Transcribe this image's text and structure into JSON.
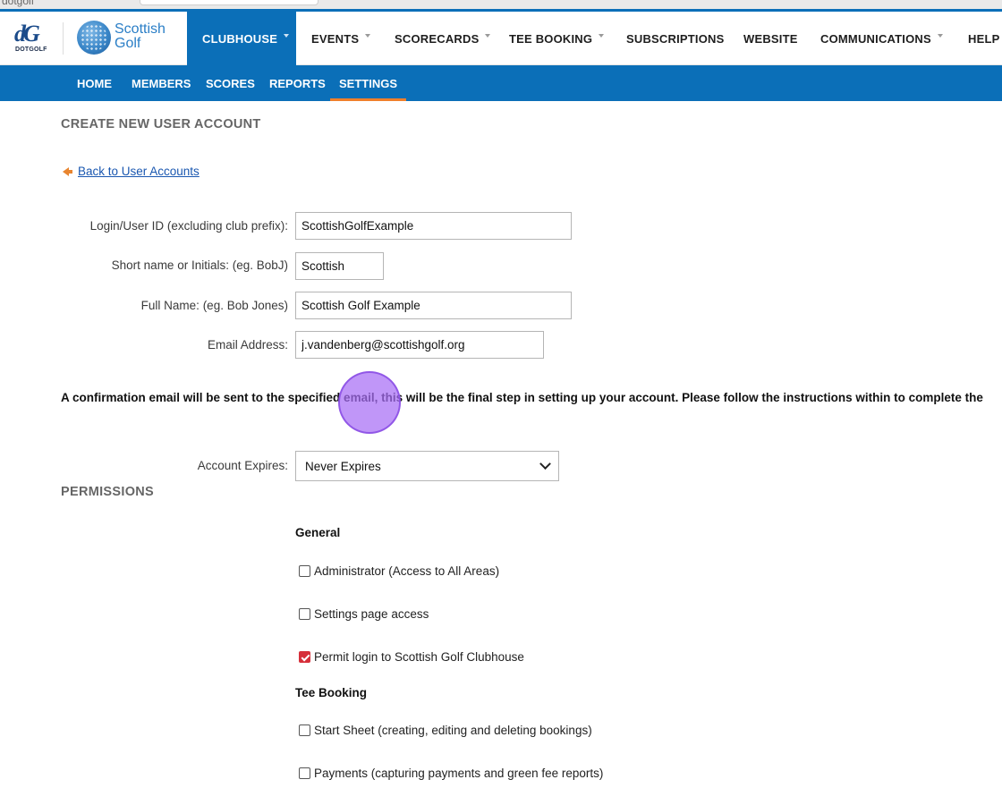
{
  "browser": {
    "tab_text": "dotgolf"
  },
  "brand": {
    "dotgolf_mark": "dG",
    "dotgolf_text": "DOTGOLF",
    "scottish_golf_line1": "Scottish",
    "scottish_golf_line2": "Golf"
  },
  "nav": {
    "items": [
      {
        "label": "CLUBHOUSE",
        "has_caret": true,
        "active": true
      },
      {
        "label": "EVENTS",
        "has_caret": true
      },
      {
        "label": "SCORECARDS",
        "has_caret": true
      },
      {
        "label": "TEE BOOKING",
        "has_caret": true
      },
      {
        "label": "SUBSCRIPTIONS",
        "has_caret": false
      },
      {
        "label": "WEBSITE",
        "has_caret": false
      },
      {
        "label": "COMMUNICATIONS",
        "has_caret": true
      },
      {
        "label": "HELP",
        "has_caret": false
      }
    ]
  },
  "subnav": {
    "items": [
      {
        "label": "HOME"
      },
      {
        "label": "MEMBERS"
      },
      {
        "label": "SCORES"
      },
      {
        "label": "REPORTS"
      },
      {
        "label": "SETTINGS",
        "active": true
      }
    ]
  },
  "page": {
    "title": "CREATE NEW USER ACCOUNT",
    "back_link": "Back to User Accounts"
  },
  "form": {
    "login_label": "Login/User ID (excluding club prefix):",
    "login_value": "ScottishGolfExample",
    "short_label": "Short name or Initials: (eg. BobJ)",
    "short_value": "Scottish",
    "fullname_label": "Full Name: (eg. Bob Jones)",
    "fullname_value": "Scottish Golf Example",
    "email_label": "Email Address:",
    "email_value": "j.vandenberg@scottishgolf.org",
    "notice": "A confirmation email will be sent to the specified email, this will be the final step in setting up your account. Please follow the instructions within to complete the",
    "expires_label": "Account Expires:",
    "expires_value": "Never Expires"
  },
  "permissions": {
    "title": "PERMISSIONS",
    "general_title": "General",
    "administrator": {
      "label": "Administrator (Access to All Areas)",
      "checked": false
    },
    "settings_access": {
      "label": "Settings page access",
      "checked": false
    },
    "permit_login": {
      "label": "Permit login to Scottish Golf Clubhouse",
      "checked": true
    },
    "tee_booking_title": "Tee Booking",
    "start_sheet": {
      "label": "Start Sheet (creating, editing and deleting bookings)",
      "checked": false
    },
    "payments": {
      "label": "Payments (capturing payments and green fee reports)",
      "checked": false
    }
  },
  "colors": {
    "brand_blue": "#0b6fb8",
    "accent_orange": "#f07f2b",
    "checkbox_red": "#d62f3a",
    "cursor_purple": "#a86ef5"
  }
}
